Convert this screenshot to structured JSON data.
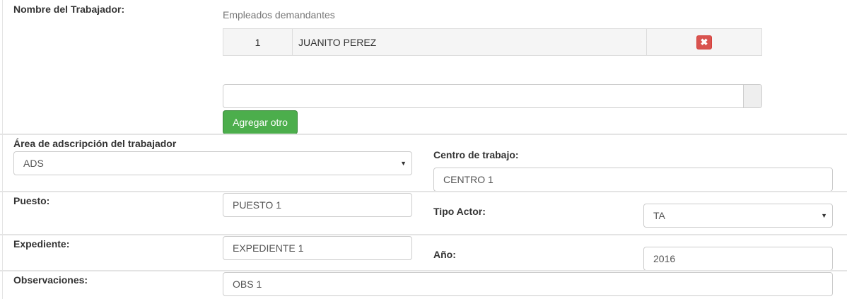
{
  "worker": {
    "label": "Nombre del Trabajador:",
    "table_title": "Empleados demandantes",
    "rows": [
      {
        "index": "1",
        "name": "JUANITO PEREZ"
      }
    ],
    "search_value": "",
    "add_button": "Agregar otro"
  },
  "area": {
    "label": "Área de adscripción del trabajador",
    "value": "ADS",
    "arrow": "▼"
  },
  "workplace": {
    "label": "Centro de trabajo:",
    "value": "CENTRO 1"
  },
  "position": {
    "label": "Puesto:",
    "value": "PUESTO 1"
  },
  "actor_type": {
    "label": "Tipo Actor:",
    "value": "TA",
    "arrow": "▼"
  },
  "file": {
    "label": "Expediente:",
    "value": "EXPEDIENTE 1"
  },
  "year": {
    "label": "Año:",
    "value": "2016"
  },
  "notes": {
    "label": "Observaciones:",
    "value": "OBS 1"
  },
  "icons": {
    "delete": "close-icon",
    "delete_glyph": "✖"
  },
  "colors": {
    "delete_red": "#d9534f",
    "add_green": "#4cae4c"
  }
}
